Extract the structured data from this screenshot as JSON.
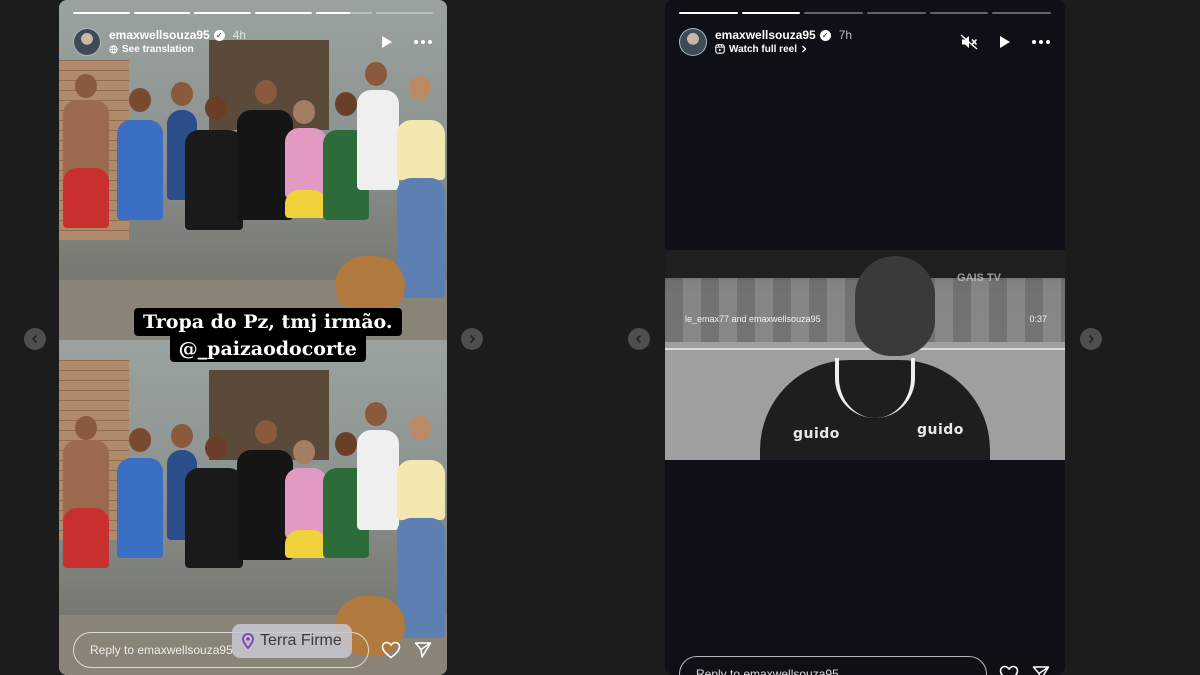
{
  "stories": [
    {
      "username": "emaxwellsouza95",
      "time": "4h",
      "sub_action": "See translation",
      "progress": [
        1,
        1,
        1,
        1,
        0.6,
        0
      ],
      "caption_line1": "Tropa do Pz, tmj irmão.",
      "caption_line2": "_paizaodocorte",
      "location": "Terra Firme",
      "reply_placeholder": "Reply to emaxwellsouza95..."
    },
    {
      "username": "emaxwellsouza95",
      "time": "7h",
      "sub_action": "Watch full reel",
      "progress": [
        1,
        1,
        0,
        0,
        0,
        0
      ],
      "reel_credit": "le_emax77 and emaxwellsouza95",
      "reel_duration": "0:37",
      "watermark": "GAIS TV",
      "sponsor_left": "guido",
      "sponsor_right": "guido",
      "reply_placeholder": "Reply to emaxwellsouza95..."
    }
  ],
  "colors": {
    "background": "#1c1c1c",
    "text": "#ffffff"
  }
}
